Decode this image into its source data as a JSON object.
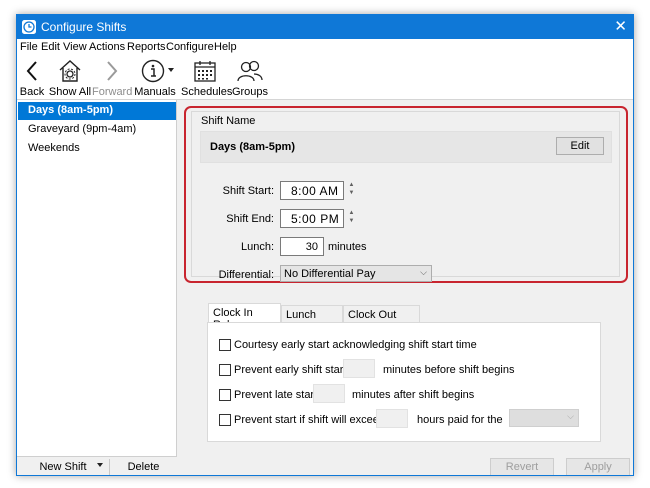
{
  "window": {
    "title": "Configure Shifts",
    "close_glyph": "✕"
  },
  "menu": [
    "File",
    "Edit",
    "View",
    "Actions",
    "Reports",
    "Configure",
    "Help"
  ],
  "toolbar": {
    "back": "Back",
    "show_all": "Show All",
    "forward": "Forward",
    "manuals": "Manuals",
    "schedules": "Schedules",
    "groups": "Groups"
  },
  "sidebar": {
    "items": [
      {
        "label": "Days (8am-5pm)"
      },
      {
        "label": "Graveyard (9pm-4am)"
      },
      {
        "label": "Weekends"
      }
    ],
    "new_shift": "New Shift",
    "delete": "Delete"
  },
  "shift": {
    "group_title": "Shift Name",
    "name": "Days (8am-5pm)",
    "edit_label": "Edit",
    "start_label": "Shift Start:",
    "start_value": "8:00 AM",
    "end_label": "Shift End:",
    "end_value": "5:00 PM",
    "lunch_label": "Lunch:",
    "lunch_value": "30",
    "lunch_unit": "minutes",
    "differential_label": "Differential:",
    "differential_value": "No Differential Pay"
  },
  "tabs": [
    "Clock In Rules",
    "Lunch Rules",
    "Clock Out Rules"
  ],
  "rules": {
    "courtesy": "Courtesy early start acknowledging shift start time",
    "prevent_early": "Prevent early shift start",
    "prevent_early_suffix": "minutes before shift begins",
    "prevent_late": "Prevent late start",
    "prevent_late_suffix": "minutes after shift begins",
    "prevent_exceed": "Prevent start if shift will exceed",
    "prevent_exceed_suffix": "hours paid for the"
  },
  "buttons": {
    "revert": "Revert",
    "apply": "Apply"
  },
  "colors": {
    "title_bar": "#0f78d7",
    "selection": "#0078d7",
    "highlight_border": "#c8252f"
  }
}
